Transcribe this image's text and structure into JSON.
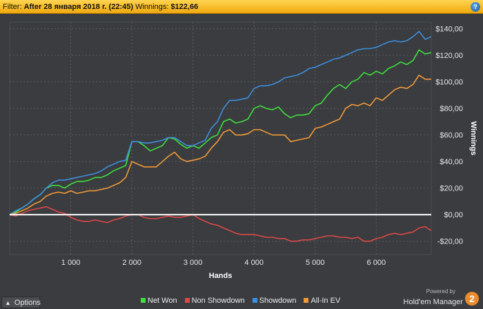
{
  "filter_bar": {
    "prefix": "Filter:",
    "filter_value": "After 28 января 2018 г. (22:45)",
    "winnings_label": "Winnings:",
    "winnings_value": "$122,66",
    "help_icon": "help-icon"
  },
  "footer": {
    "options_label": "Options",
    "options_icon": "chevron-up-icon",
    "powered_by": "Powered by",
    "brand": "Hold'em Manager",
    "brand_badge": "2"
  },
  "colors": {
    "background": "#3a3c3f",
    "grid": "#5a5d61",
    "zero_line": "#ffffff",
    "net_won": "#3ee03e",
    "non_showdown": "#e04848",
    "showdown": "#3d8fe0",
    "all_in_ev": "#f29a38"
  },
  "chart_data": {
    "type": "line",
    "xlabel": "Hands",
    "ylabel": "Winnings",
    "xlim": [
      0,
      6900
    ],
    "ylim": [
      -30,
      145
    ],
    "x_ticks": [
      1000,
      2000,
      3000,
      4000,
      5000,
      6000
    ],
    "x_tick_labels": [
      "1 000",
      "2 000",
      "3 000",
      "4 000",
      "5 000",
      "6 000"
    ],
    "y_ticks": [
      -20,
      0,
      20,
      40,
      60,
      80,
      100,
      120,
      140
    ],
    "y_tick_labels": [
      "-$20,00",
      "$0,00",
      "$20,00",
      "$40,00",
      "$60,00",
      "$80,00",
      "$100,00",
      "$120,00",
      "$140,00"
    ],
    "grid": true,
    "legend_position": "bottom",
    "series": [
      {
        "name": "Net Won",
        "color": "#3ee03e",
        "x": [
          0,
          100,
          200,
          300,
          400,
          500,
          600,
          700,
          800,
          900,
          1000,
          1100,
          1200,
          1300,
          1400,
          1500,
          1600,
          1700,
          1800,
          1900,
          2000,
          2100,
          2200,
          2300,
          2400,
          2500,
          2600,
          2700,
          2800,
          2900,
          3000,
          3100,
          3200,
          3300,
          3400,
          3500,
          3600,
          3700,
          3800,
          3900,
          4000,
          4100,
          4200,
          4300,
          4400,
          4500,
          4600,
          4700,
          4800,
          4900,
          5000,
          5100,
          5200,
          5300,
          5400,
          5500,
          5600,
          5700,
          5800,
          5900,
          6000,
          6100,
          6200,
          6300,
          6400,
          6500,
          6600,
          6700,
          6800,
          6900
        ],
        "y": [
          0,
          2,
          5,
          8,
          12,
          15,
          20,
          22,
          22,
          20,
          23,
          25,
          25,
          26,
          28,
          28,
          30,
          33,
          35,
          37,
          55,
          55,
          52,
          48,
          50,
          52,
          58,
          57,
          53,
          50,
          52,
          50,
          54,
          58,
          60,
          70,
          72,
          69,
          70,
          72,
          80,
          82,
          80,
          79,
          81,
          76,
          73,
          75,
          75,
          76,
          82,
          84,
          90,
          95,
          98,
          95,
          100,
          102,
          107,
          105,
          108,
          106,
          110,
          112,
          115,
          113,
          116,
          124,
          121,
          122
        ]
      },
      {
        "name": "Non Showdown",
        "color": "#e04848",
        "x": [
          0,
          100,
          200,
          300,
          400,
          500,
          600,
          700,
          800,
          900,
          1000,
          1100,
          1200,
          1300,
          1400,
          1500,
          1600,
          1700,
          1800,
          1900,
          2000,
          2100,
          2200,
          2300,
          2400,
          2500,
          2600,
          2700,
          2800,
          2900,
          3000,
          3100,
          3200,
          3300,
          3400,
          3500,
          3600,
          3700,
          3800,
          3900,
          4000,
          4100,
          4200,
          4300,
          4400,
          4500,
          4600,
          4700,
          4800,
          4900,
          5000,
          5100,
          5200,
          5300,
          5400,
          5500,
          5600,
          5700,
          5800,
          5900,
          6000,
          6100,
          6200,
          6300,
          6400,
          6500,
          6600,
          6700,
          6800,
          6900
        ],
        "y": [
          0,
          -1,
          1,
          3,
          4,
          5,
          6,
          4,
          2,
          1,
          -2,
          -4,
          -5,
          -5,
          -4,
          -5,
          -6,
          -4,
          -3,
          -1,
          0,
          0,
          -2,
          -3,
          -3,
          -2,
          -1,
          -2,
          -2,
          -1,
          0,
          -3,
          -5,
          -7,
          -8,
          -10,
          -12,
          -14,
          -15,
          -15,
          -15,
          -16,
          -17,
          -17,
          -18,
          -18,
          -20,
          -20,
          -19,
          -19,
          -18,
          -17,
          -16,
          -16,
          -17,
          -17,
          -18,
          -17,
          -20,
          -20,
          -18,
          -17,
          -15,
          -14,
          -15,
          -14,
          -13,
          -10,
          -9,
          -12
        ]
      },
      {
        "name": "Showdown",
        "color": "#3d8fe0",
        "x": [
          0,
          100,
          200,
          300,
          400,
          500,
          600,
          700,
          800,
          900,
          1000,
          1100,
          1200,
          1300,
          1400,
          1500,
          1600,
          1700,
          1800,
          1900,
          2000,
          2100,
          2200,
          2300,
          2400,
          2500,
          2600,
          2700,
          2800,
          2900,
          3000,
          3100,
          3200,
          3300,
          3400,
          3500,
          3600,
          3700,
          3800,
          3900,
          4000,
          4100,
          4200,
          4300,
          4400,
          4500,
          4600,
          4700,
          4800,
          4900,
          5000,
          5100,
          5200,
          5300,
          5400,
          5500,
          5600,
          5700,
          5800,
          5900,
          6000,
          6100,
          6200,
          6300,
          6400,
          6500,
          6600,
          6700,
          6800,
          6900
        ],
        "y": [
          0,
          3,
          5,
          8,
          12,
          15,
          20,
          24,
          26,
          26,
          27,
          28,
          29,
          30,
          31,
          33,
          36,
          38,
          40,
          41,
          55,
          55,
          54,
          54,
          55,
          56,
          58,
          58,
          55,
          52,
          52,
          54,
          56,
          65,
          70,
          80,
          86,
          86,
          87,
          88,
          95,
          97,
          97,
          98,
          100,
          103,
          104,
          105,
          107,
          110,
          111,
          113,
          115,
          117,
          118,
          120,
          122,
          124,
          125,
          125,
          126,
          128,
          130,
          131,
          130,
          131,
          134,
          138,
          132,
          134
        ]
      },
      {
        "name": "All-In EV",
        "color": "#f29a38",
        "x": [
          0,
          100,
          200,
          300,
          400,
          500,
          600,
          700,
          800,
          900,
          1000,
          1100,
          1200,
          1300,
          1400,
          1500,
          1600,
          1700,
          1800,
          1900,
          2000,
          2100,
          2200,
          2300,
          2400,
          2500,
          2600,
          2700,
          2800,
          2900,
          3000,
          3100,
          3200,
          3300,
          3400,
          3500,
          3600,
          3700,
          3800,
          3900,
          4000,
          4100,
          4200,
          4300,
          4400,
          4500,
          4600,
          4700,
          4800,
          4900,
          5000,
          5100,
          5200,
          5300,
          5400,
          5500,
          5600,
          5700,
          5800,
          5900,
          6000,
          6100,
          6200,
          6300,
          6400,
          6500,
          6600,
          6700,
          6800,
          6900
        ],
        "y": [
          0,
          1,
          3,
          5,
          8,
          10,
          14,
          16,
          17,
          16,
          18,
          16,
          17,
          18,
          18,
          19,
          20,
          22,
          24,
          28,
          40,
          38,
          36,
          36,
          36,
          40,
          44,
          47,
          42,
          40,
          41,
          42,
          44,
          50,
          55,
          62,
          64,
          60,
          60,
          61,
          64,
          64,
          62,
          60,
          60,
          60,
          55,
          56,
          57,
          58,
          65,
          66,
          68,
          70,
          72,
          80,
          83,
          82,
          84,
          82,
          88,
          86,
          90,
          94,
          96,
          95,
          98,
          105,
          102,
          102
        ]
      }
    ]
  }
}
